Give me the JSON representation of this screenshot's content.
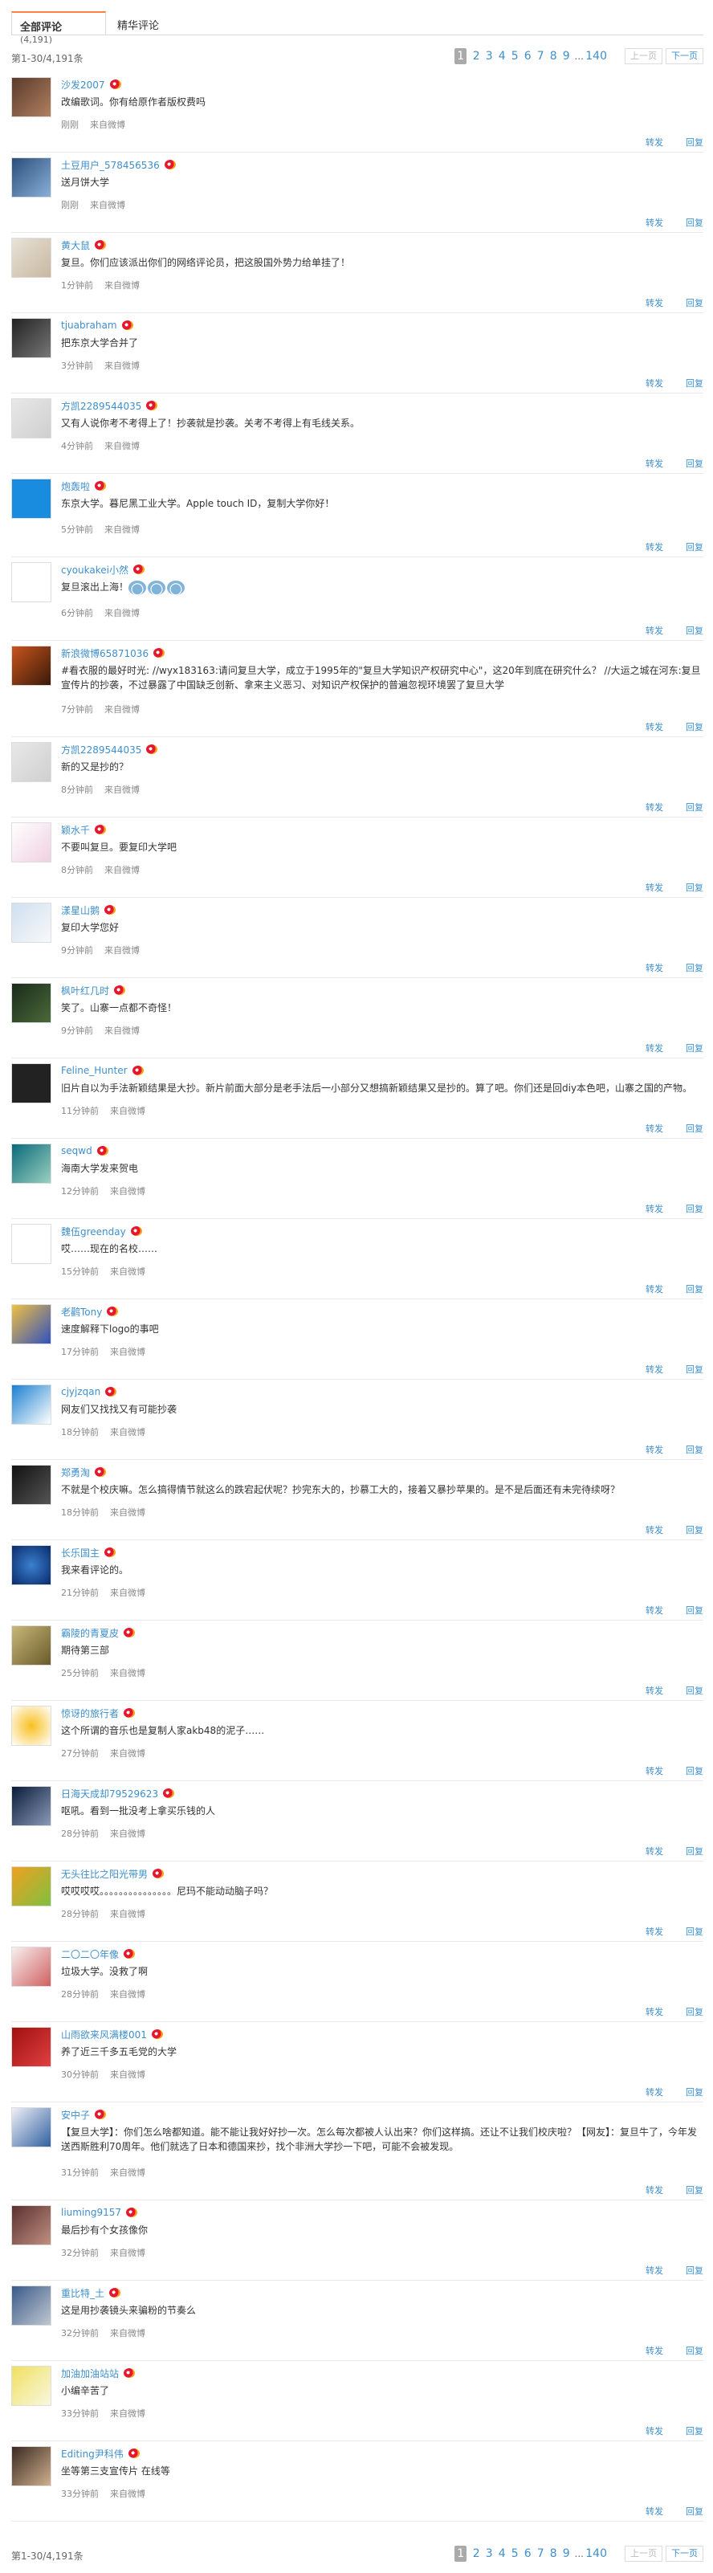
{
  "tabs": {
    "all_label": "全部评论",
    "all_count": "(4,191)",
    "featured_label": "精华评论"
  },
  "pagination": {
    "count_text": "第1-30/4,191条",
    "pages": [
      "1",
      "2",
      "3",
      "4",
      "5",
      "6",
      "7",
      "8",
      "9"
    ],
    "dots": "...",
    "last": "140",
    "prev": "上一页",
    "next": "下一页",
    "footer_count_text": "第1-30/4,191条"
  },
  "actions": {
    "forward": "转发",
    "reply": "回复"
  },
  "colors": {
    "accent": "#ff8140",
    "link": "#3e8fcc",
    "weibo": "#e6162d"
  },
  "comments": [
    {
      "name": "沙发2007",
      "text": "改编歌词。你有给原作者版权费吗",
      "time": "刚刚",
      "source": "来自微博",
      "avatar": "avatar-photo-1"
    },
    {
      "name": "土豆用户_578456536",
      "text": "送月饼大学",
      "time": "刚刚",
      "source": "来自微博",
      "avatar": "avatar-photo-2"
    },
    {
      "name": "黄大鼠",
      "text": "复旦。你们应该派出你们的网络评论员，把这股国外势力给单挂了！",
      "time": "1分钟前",
      "source": "来自微博",
      "avatar": "avatar-photo-3"
    },
    {
      "name": "tjuabraham",
      "text": "把东京大学合并了",
      "time": "3分钟前",
      "source": "来自微博",
      "avatar": "avatar-photo-4"
    },
    {
      "name": "方凯2289544035",
      "text": "又有人说你考不考得上了！抄袭就是抄袭。关考不考得上有毛线关系。",
      "time": "4分钟前",
      "source": "来自微博",
      "avatar": "avatar-default-1"
    },
    {
      "name": "炮轰啦",
      "text": "东京大学。暮尼黑工业大学。Apple touch ID，复制大学你好！",
      "time": "5分钟前",
      "source": "来自微博",
      "avatar": "avatar-blue-logo"
    },
    {
      "name": "cyoukakei小然",
      "text": "复旦滚出上海！",
      "time": "6分钟前",
      "source": "来自微博",
      "avatar": "avatar-kobe-logo"
    },
    {
      "name": "新浪微博65871036",
      "text": "#看衣服的最好时光: //wyx183163:请问复旦大学，成立于1995年的\"复旦大学知识产权研究中心\"，这20年到底在研究什么？ //大运之城在河东:复旦宣传片的抄袭，不过暴露了中国缺乏创新、拿来主义恶习、对知识产权保护的普遍忽视环境罢了复旦大学",
      "time": "7分钟前",
      "source": "来自微博",
      "avatar": "avatar-photo-5"
    },
    {
      "name": "方凯2289544035",
      "text": "新的又是抄的？",
      "time": "8分钟前",
      "source": "来自微博",
      "avatar": "avatar-default-2"
    },
    {
      "name": "颖水千",
      "text": "不要叫复旦。要复印大学吧",
      "time": "8分钟前",
      "source": "来自微博",
      "avatar": "avatar-cat"
    },
    {
      "name": "漾星山鹅",
      "text": "复印大学您好",
      "time": "9分钟前",
      "source": "来自微博",
      "avatar": "avatar-anime"
    },
    {
      "name": "枫叶红几时",
      "text": "笑了。山寨一点都不奇怪！",
      "time": "9分钟前",
      "source": "来自微博",
      "avatar": "avatar-photo-6"
    },
    {
      "name": "Feline_Hunter",
      "text": "旧片自以为手法新颖结果是大抄。新片前面大部分是老手法后一小部分又想搞新颖结果又是抄的。算了吧。你们还是回diy本色吧，山寨之国的产物。",
      "time": "11分钟前",
      "source": "来自微博",
      "avatar": "avatar-calligraphy"
    },
    {
      "name": "seqwd",
      "text": "海南大学发来贺电",
      "time": "12分钟前",
      "source": "来自微博",
      "avatar": "avatar-landscape"
    },
    {
      "name": "魏伍greenday",
      "text": "哎……现在的名校……",
      "time": "15分钟前",
      "source": "来自微博",
      "avatar": "avatar-che"
    },
    {
      "name": "老鹳Tony",
      "text": "速度解释下logo的事吧",
      "time": "17分钟前",
      "source": "来自微博",
      "avatar": "avatar-pixel"
    },
    {
      "name": "cjyjzqan",
      "text": "网友们又找找又有可能抄袭",
      "time": "18分钟前",
      "source": "来自微博",
      "avatar": "avatar-doraemon"
    },
    {
      "name": "郑勇淘",
      "text": "不就是个校庆嘛。怎么搞得情节就这么的跌宕起伏呢？抄完东大的，抄慕工大的，接着又暴抄苹果的。是不是后面还有未完待续呀？",
      "time": "18分钟前",
      "source": "来自微博",
      "avatar": "avatar-photo-7"
    },
    {
      "name": "长乐国主",
      "text": "我来看评论的。",
      "time": "21分钟前",
      "source": "来自微博",
      "avatar": "avatar-globe"
    },
    {
      "name": "霸陵的青夏皮",
      "text": "期待第三部",
      "time": "25分钟前",
      "source": "来自微博",
      "avatar": "avatar-painting"
    },
    {
      "name": "惊讶的旅行者",
      "text": "这个所谓的音乐也是复制人家akb48的泥子……",
      "time": "27分钟前",
      "source": "来自微博",
      "avatar": "avatar-sun"
    },
    {
      "name": "日海天成却79529623",
      "text": "呕吼。看到一批没考上拿买乐钱的人",
      "time": "28分钟前",
      "source": "来自微博",
      "avatar": "avatar-night"
    },
    {
      "name": "无头往比之阳光带男",
      "text": "哎哎哎哎。。。。。。。。。。。。。。。尼玛不能动动脑子吗？",
      "time": "28分钟前",
      "source": "来自微博",
      "avatar": "avatar-cartoon"
    },
    {
      "name": "二〇二〇年像",
      "text": "垃圾大学。没救了啊",
      "time": "28分钟前",
      "source": "来自微博",
      "avatar": "avatar-sketch"
    },
    {
      "name": "山雨欲来风满楼001",
      "text": "养了近三千多五毛党的大学",
      "time": "30分钟前",
      "source": "来自微博",
      "avatar": "avatar-red"
    },
    {
      "name": "安中子",
      "text": "【复旦大学】：你们怎么啥都知道。能不能让我好好抄一次。怎么每次都被人认出来？你们这样搞。还让不让我们校庆啦？【网友】：复旦牛了，今年发送西斯胜利70周年。他们就选了日本和德国来抄，找个非洲大学抄一下吧，可能不会被发现。",
      "time": "31分钟前",
      "source": "来自微博",
      "avatar": "avatar-anime-2"
    },
    {
      "name": "liuming9157",
      "text": "最后抄有个女孩像你",
      "time": "32分钟前",
      "source": "来自微博",
      "avatar": "avatar-photo-8"
    },
    {
      "name": "重比特_土",
      "text": "这是用抄袭镜头来骗粉的节奏么",
      "time": "32分钟前",
      "source": "来自微博",
      "avatar": "avatar-photo-9"
    },
    {
      "name": "加油加油站站",
      "text": "小编辛苦了",
      "time": "33分钟前",
      "source": "来自微博",
      "avatar": "avatar-yellow"
    },
    {
      "name": "Editing尹科伟",
      "text": "坐等第三支宣传片 在线等",
      "time": "33分钟前",
      "source": "来自微博",
      "avatar": "avatar-girl"
    }
  ]
}
